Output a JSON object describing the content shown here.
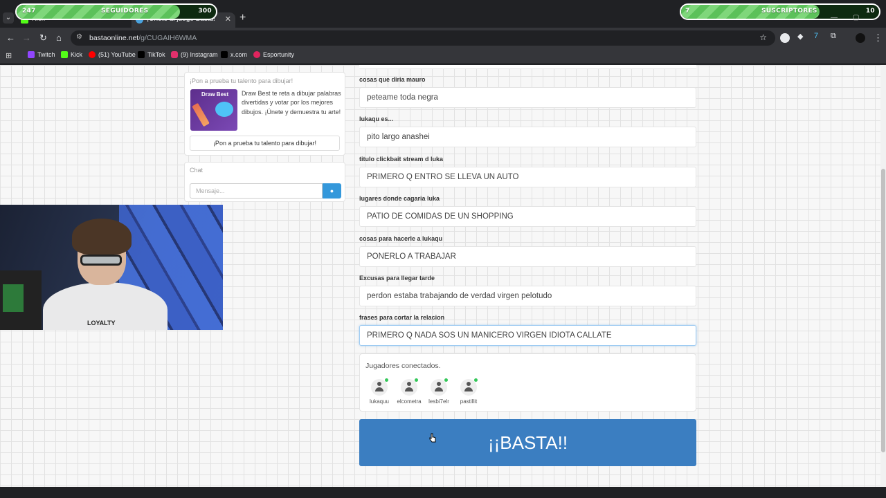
{
  "overlay": {
    "followers": {
      "current": "247",
      "label": "SEGUIDORES",
      "goal": "300",
      "progress": 0.82
    },
    "subscribers": {
      "current": "7",
      "label": "SUSCRIPTORES",
      "goal": "10",
      "progress": 0.7
    }
  },
  "tabs": [
    {
      "label": "Kick",
      "icon": "kick-icon"
    },
    {
      "label": "¡Únete al juego Basta!",
      "icon": "basta-icon"
    }
  ],
  "address": {
    "host": "bastaonline.net",
    "path": "/g/CUGAIH6WMA"
  },
  "bookmarks": [
    {
      "label": "Twitch",
      "color": "#9146ff"
    },
    {
      "label": "Kick",
      "color": "#53fc18"
    },
    {
      "label": "(51) YouTube",
      "color": "#ff0000"
    },
    {
      "label": "TikTok",
      "color": "#000000"
    },
    {
      "label": "(9) Instagram",
      "color": "#e1306c"
    },
    {
      "label": "x.com",
      "color": "#000000"
    },
    {
      "label": "Esportunity",
      "color": "#e0245e"
    }
  ],
  "promo": {
    "title": "¡Pon a prueba tu talento para dibujar!",
    "image_label": "Draw Best",
    "text": "Draw Best te reta a dibujar palabras divertidas y votar por los mejores dibujos. ¡Únete y demuestra tu arte!",
    "button": "¡Pon a prueba tu talento para dibujar!"
  },
  "chat": {
    "title": "Chat",
    "placeholder": "Mensaje..."
  },
  "webcam": {
    "shirt_text": "LOYALTY"
  },
  "fields": [
    {
      "label": "cosas que diria mauro",
      "value": "peteame toda negra"
    },
    {
      "label": "lukaqu es...",
      "value": "pito largo anashei"
    },
    {
      "label": "titulo clickbait stream d luka",
      "value": "PRIMERO Q ENTRO SE LLEVA UN AUTO"
    },
    {
      "label": "lugares donde cagaria luka",
      "value": "PATIO DE COMIDAS DE UN SHOPPING"
    },
    {
      "label": "cosas para hacerle a lukaqu",
      "value": "PONERLO A TRABAJAR"
    },
    {
      "label": "Excusas para llegar tarde",
      "value": "perdon estaba trabajando de verdad virgen pelotudo"
    },
    {
      "label": "frases para cortar la relacion",
      "value": "PRIMERO Q NADA SOS UN MANICERO VIRGEN IDIOTA CALLATE"
    }
  ],
  "players": {
    "title": "Jugadores conectados.",
    "list": [
      {
        "name": "lukaquu"
      },
      {
        "name": "elcometra"
      },
      {
        "name": "lesbi7elr"
      },
      {
        "name": "pastillit"
      }
    ]
  },
  "basta_button": "¡¡BASTA!!"
}
